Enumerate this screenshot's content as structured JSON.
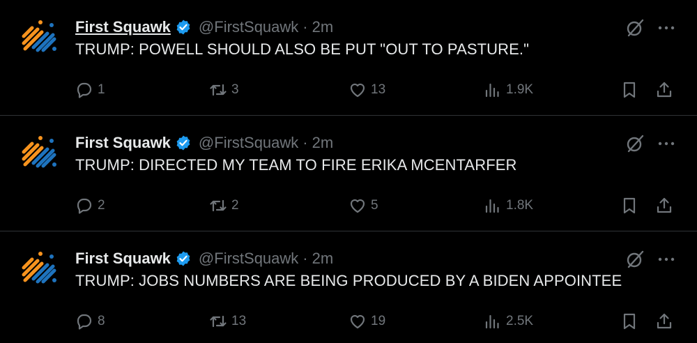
{
  "tweets": [
    {
      "name": "First Squawk",
      "handle": "@FirstSquawk",
      "separator": "·",
      "time": "2m",
      "text": "TRUMP: POWELL SHOULD ALSO BE PUT \"OUT TO PASTURE.\"",
      "replies": "1",
      "retweets": "3",
      "likes": "13",
      "views": "1.9K"
    },
    {
      "name": "First Squawk",
      "handle": "@FirstSquawk",
      "separator": "·",
      "time": "2m",
      "text": "TRUMP: DIRECTED MY TEAM TO FIRE ERIKA MCENTARFER",
      "replies": "2",
      "retweets": "2",
      "likes": "5",
      "views": "1.8K"
    },
    {
      "name": "First Squawk",
      "handle": "@FirstSquawk",
      "separator": "·",
      "time": "2m",
      "text": "TRUMP: JOBS NUMBERS ARE BEING PRODUCED BY A BIDEN APPOINTEE",
      "replies": "8",
      "retweets": "13",
      "likes": "19",
      "views": "2.5K"
    }
  ],
  "colors": {
    "background": "#000000",
    "text": "#e7e9ea",
    "muted": "#71767b",
    "verified": "#1d9bf0",
    "logo_orange": "#f7931e",
    "logo_blue": "#1e73be",
    "divider": "#2f3336"
  },
  "icons": [
    "reply-icon",
    "retweet-icon",
    "like-icon",
    "views-icon",
    "bookmark-icon",
    "share-icon",
    "grok-icon",
    "more-icon",
    "verified-badge-icon"
  ]
}
